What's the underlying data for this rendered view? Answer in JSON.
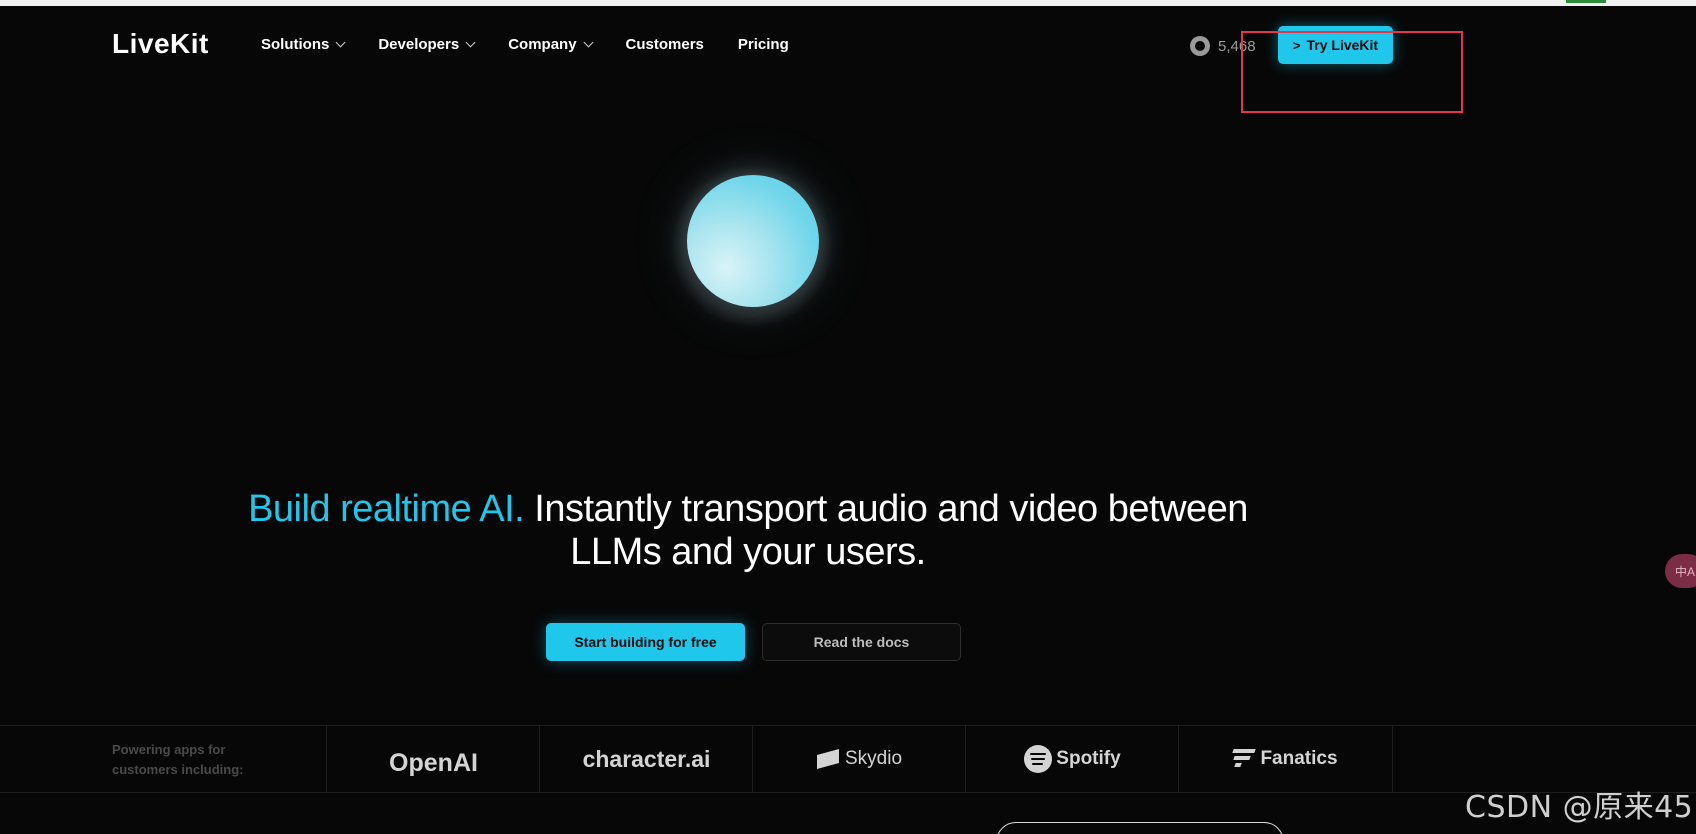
{
  "brand": {
    "logo_text": "LiveKit",
    "accent_color": "#1fc7ea"
  },
  "nav": {
    "items": [
      {
        "label": "Solutions",
        "has_dropdown": true
      },
      {
        "label": "Developers",
        "has_dropdown": true
      },
      {
        "label": "Company",
        "has_dropdown": true
      },
      {
        "label": "Customers",
        "has_dropdown": false
      },
      {
        "label": "Pricing",
        "has_dropdown": false
      }
    ],
    "github_stars": "5,468",
    "cta_label": "Try LiveKit"
  },
  "hero": {
    "headline_accent": "Build realtime AI.",
    "headline_rest": " Instantly transport audio and video between LLMs and your users.",
    "primary_cta": "Start building for free",
    "secondary_cta": "Read the docs"
  },
  "customers": {
    "label": "Powering apps for customers including:",
    "logos": [
      "OpenAI",
      "character.ai",
      "Skydio",
      "Spotify",
      "Fanatics"
    ]
  },
  "overlays": {
    "translate_glyph": "中A",
    "watermark": "CSDN @原来45",
    "annotation_color": "#e3354b"
  }
}
